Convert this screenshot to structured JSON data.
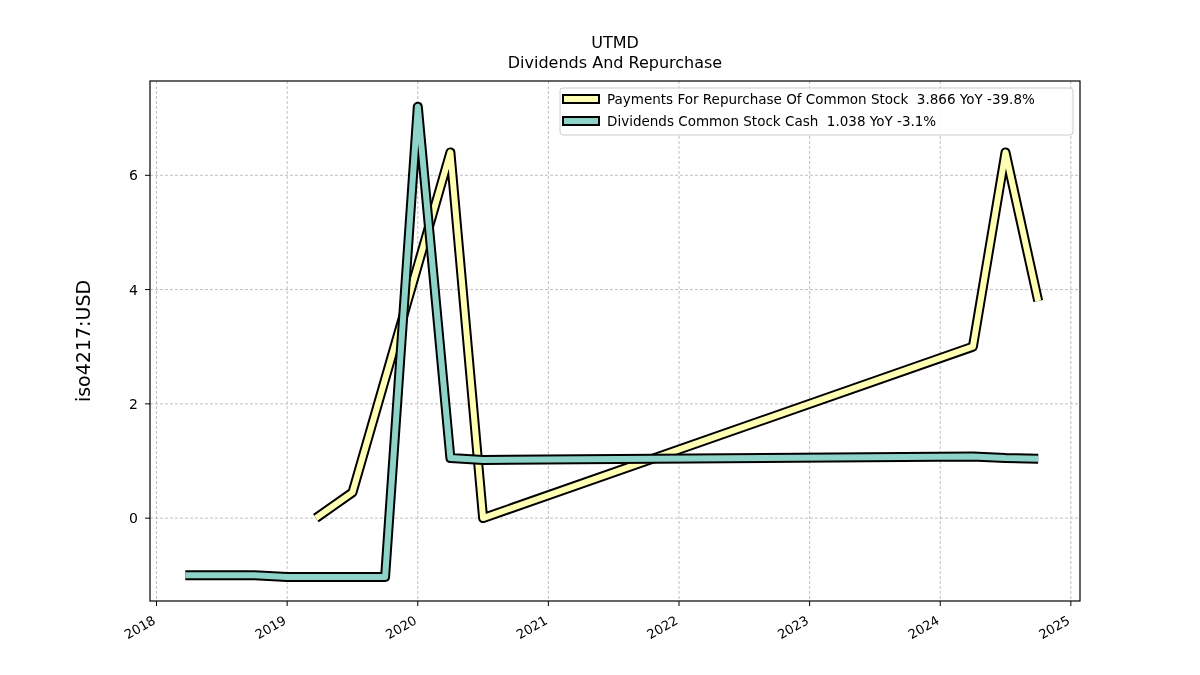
{
  "ticker": "UTMD",
  "chart_data": {
    "type": "line",
    "title": "Dividends And Repurchase",
    "ylabel": "iso4217:USD",
    "xlim": [
      2017.95,
      2025.07
    ],
    "ylim": [
      -1.45,
      7.65
    ],
    "xticks": [
      2018,
      2019,
      2020,
      2021,
      2022,
      2023,
      2024,
      2025
    ],
    "yticks": [
      0,
      2,
      4,
      6
    ],
    "grid": true,
    "legend": true,
    "series": [
      {
        "name": "Payments For Repurchase Of Common Stock  3.866 YoY -39.8%",
        "color": "#ffffb3",
        "x": [
          2019.22,
          2019.5,
          2020.25,
          2020.5,
          2024.25,
          2024.5,
          2024.75
        ],
        "values": [
          0.0,
          0.45,
          6.4,
          0.0,
          3.0,
          6.4,
          3.8
        ]
      },
      {
        "name": "Dividends Common Stock Cash  1.038 YoY -3.1%",
        "color": "#8dd3c7",
        "x": [
          2018.22,
          2018.75,
          2019.0,
          2019.75,
          2020.0,
          2020.25,
          2020.5,
          2024.25,
          2024.5,
          2024.75
        ],
        "values": [
          -1.0,
          -1.0,
          -1.03,
          -1.03,
          7.2,
          1.05,
          1.02,
          1.08,
          1.05,
          1.04
        ]
      }
    ]
  }
}
